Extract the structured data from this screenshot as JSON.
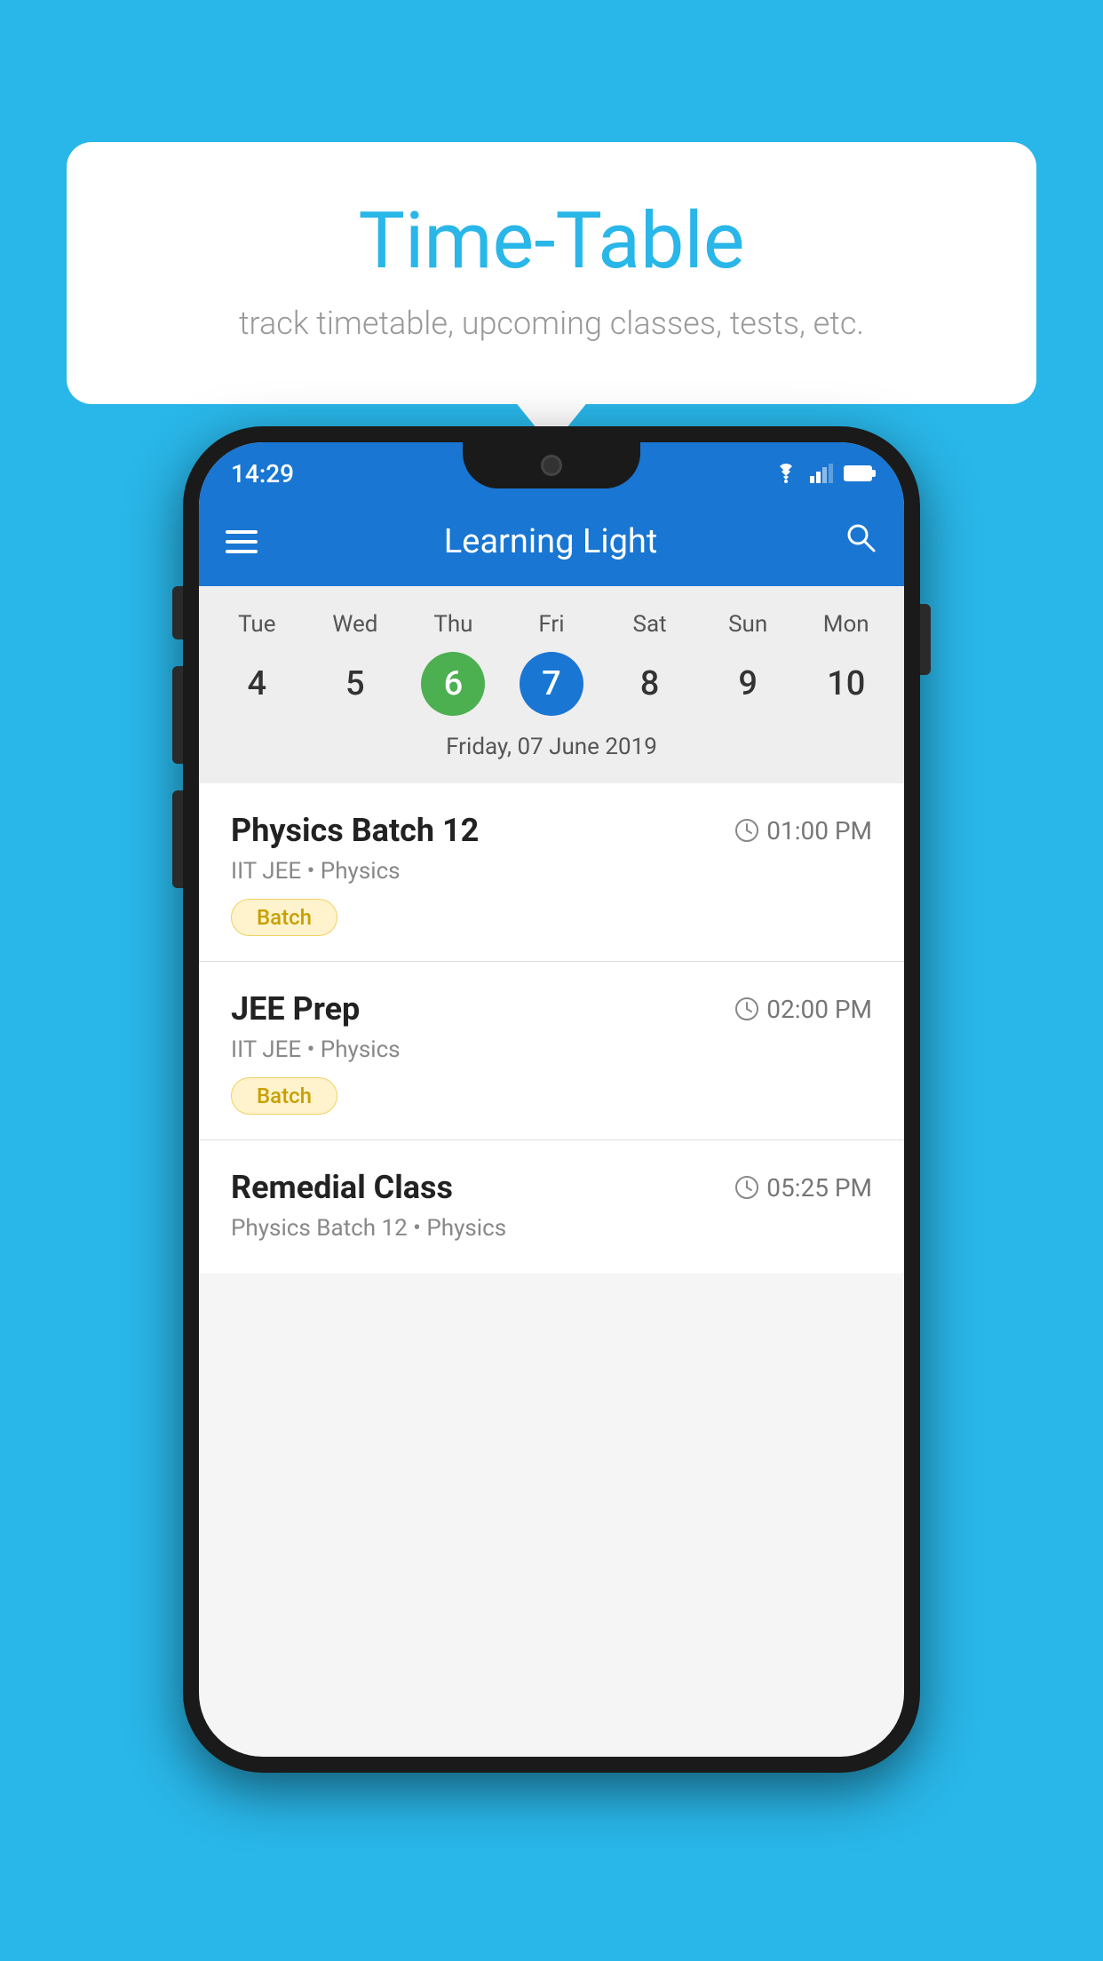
{
  "background_color": "#29b6e8",
  "tooltip": {
    "title": "Time-Table",
    "subtitle": "track timetable, upcoming classes, tests, etc."
  },
  "status_bar": {
    "time": "14:29"
  },
  "app_bar": {
    "title": "Learning Light"
  },
  "calendar": {
    "days": [
      {
        "short": "Tue",
        "num": "4"
      },
      {
        "short": "Wed",
        "num": "5"
      },
      {
        "short": "Thu",
        "num": "6",
        "state": "today"
      },
      {
        "short": "Fri",
        "num": "7",
        "state": "selected"
      },
      {
        "short": "Sat",
        "num": "8"
      },
      {
        "short": "Sun",
        "num": "9"
      },
      {
        "short": "Mon",
        "num": "10"
      }
    ],
    "selected_date_label": "Friday, 07 June 2019"
  },
  "classes": [
    {
      "name": "Physics Batch 12",
      "time": "01:00 PM",
      "subtitle": "IIT JEE • Physics",
      "tag": "Batch"
    },
    {
      "name": "JEE Prep",
      "time": "02:00 PM",
      "subtitle": "IIT JEE • Physics",
      "tag": "Batch"
    },
    {
      "name": "Remedial Class",
      "time": "05:25 PM",
      "subtitle": "Physics Batch 12 • Physics",
      "tag": null
    }
  ]
}
